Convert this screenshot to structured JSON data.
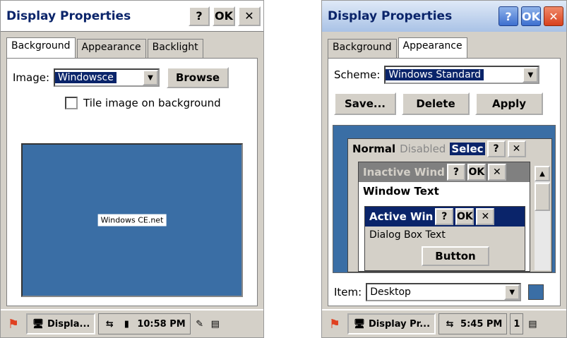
{
  "left": {
    "title": "Display Properties",
    "title_buttons": {
      "help": "?",
      "ok": "OK",
      "close": "✕"
    },
    "tabs": [
      "Background",
      "Appearance",
      "Backlight"
    ],
    "image_label": "Image:",
    "image_value": "Windowsce",
    "browse_label": "Browse",
    "tile_label": "Tile image on background",
    "logo_text": "Windows CE.net",
    "taskbar": {
      "task": "Displa...",
      "time": "10:58 PM"
    }
  },
  "right": {
    "title": "Display Properties",
    "title_buttons": {
      "help": "?",
      "ok": "OK",
      "close": "✕"
    },
    "tabs": [
      "Background",
      "Appearance"
    ],
    "scheme_label": "Scheme:",
    "scheme_value": "Windows Standard",
    "save_label": "Save...",
    "delete_label": "Delete",
    "apply_label": "Apply",
    "preview": {
      "normal": "Normal",
      "disabled": "Disabled",
      "selected": "Selec",
      "inactive": "Inactive Wind",
      "window_text": "Window Text",
      "active": "Active Win",
      "dialog_text": "Dialog Box Text",
      "button": "Button"
    },
    "item_label": "Item:",
    "item_value": "Desktop",
    "taskbar": {
      "task": "Display Pr...",
      "time": "5:45 PM",
      "badge": "1"
    }
  },
  "colors": {
    "desktop": "#3a6ea5",
    "titlebar_text": "#0a246a",
    "selection": "#0a246a"
  }
}
